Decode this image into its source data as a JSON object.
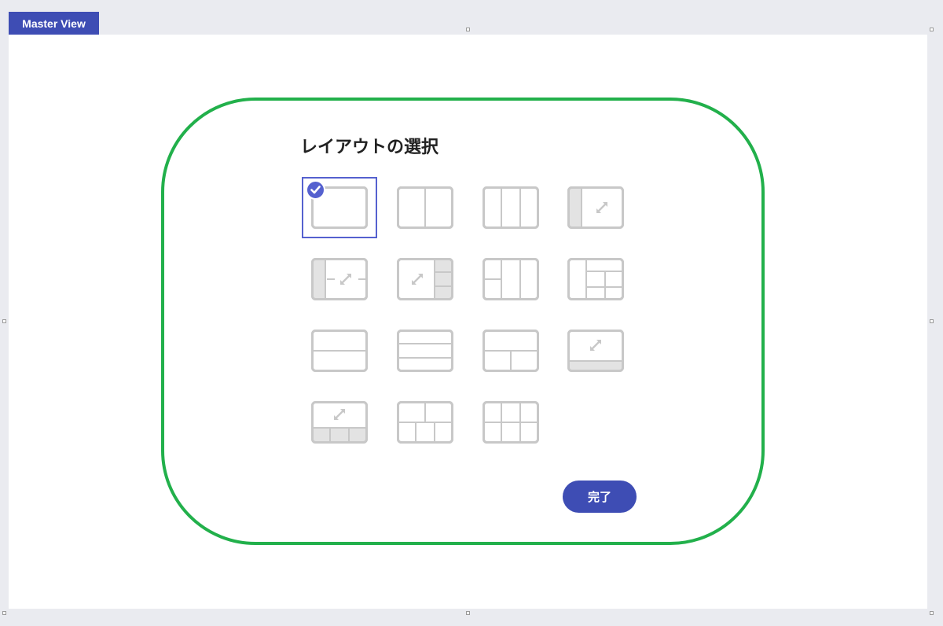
{
  "tab": {
    "label": "Master View"
  },
  "dialog": {
    "title": "レイアウトの選択",
    "done_label": "完了",
    "selected_index": 0
  },
  "layouts": [
    {
      "name": "single"
    },
    {
      "name": "two-columns"
    },
    {
      "name": "three-columns"
    },
    {
      "name": "left-sidebar-expandable"
    },
    {
      "name": "left-sidebar-split-expandable"
    },
    {
      "name": "right-stack-expandable"
    },
    {
      "name": "left-split-three-columns"
    },
    {
      "name": "complex-grid-right"
    },
    {
      "name": "two-rows"
    },
    {
      "name": "three-rows"
    },
    {
      "name": "top-row-bottom-split"
    },
    {
      "name": "bottom-bar-expandable"
    },
    {
      "name": "bottom-three-expandable"
    },
    {
      "name": "top-split-bottom-three"
    },
    {
      "name": "grid-three-by-two"
    }
  ],
  "colors": {
    "accent": "#3e4db4",
    "selection": "#5561cf",
    "outline": "#22b04b",
    "thumb_stroke": "#c8c8c8",
    "thumb_fill": "#e3e3e3"
  }
}
